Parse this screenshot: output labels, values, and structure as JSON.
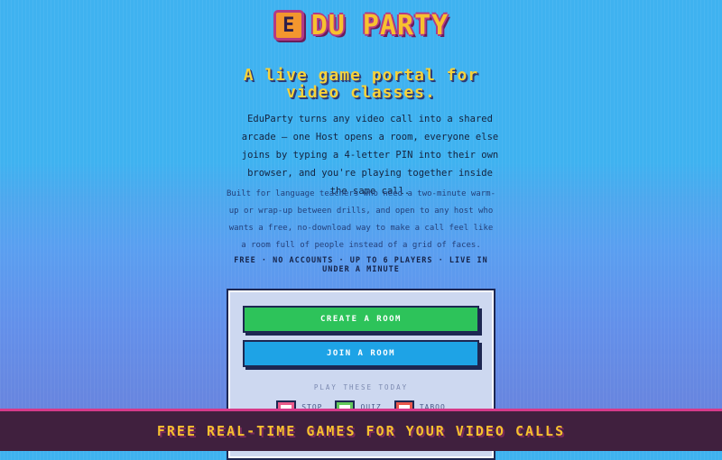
{
  "logo": {
    "badge_letter": "E",
    "text": "DU PARTY"
  },
  "hero": {
    "headline_line1": "A live game portal for",
    "headline_line2": "video classes.",
    "lead": "EduParty turns any video call into a shared arcade — one Host opens a room, everyone else joins by typing a 4-letter PIN into their own browser, and you're playing together inside the same call.",
    "sub": "Built for language teachers who need a two-minute warm-up or wrap-up between drills, and open to any host who wants a free, no-download way to make a call feel like a room full of people instead of a grid of faces.",
    "tags": "FREE · NO ACCOUNTS · UP TO 6 PLAYERS · LIVE IN UNDER A MINUTE"
  },
  "panel": {
    "create_label": "CREATE A ROOM",
    "join_label": "JOIN A ROOM",
    "play_label": "PLAY THESE TODAY",
    "games": [
      {
        "label": "STOP",
        "icon": "stop-game-icon",
        "color": "#e85a8a"
      },
      {
        "label": "QUIZ",
        "icon": "quiz-game-icon",
        "color": "#63c85a"
      },
      {
        "label": "TABOO",
        "icon": "taboo-game-icon",
        "color": "#e8564a"
      }
    ]
  },
  "banner": {
    "text": "FREE REAL-TIME GAMES FOR YOUR VIDEO CALLS"
  },
  "colors": {
    "accent_yellow": "#f7c12f",
    "create_green": "#2dc35a",
    "join_blue": "#1ea3e6",
    "banner_bg": "#40203e",
    "banner_border": "#d63a8a"
  }
}
